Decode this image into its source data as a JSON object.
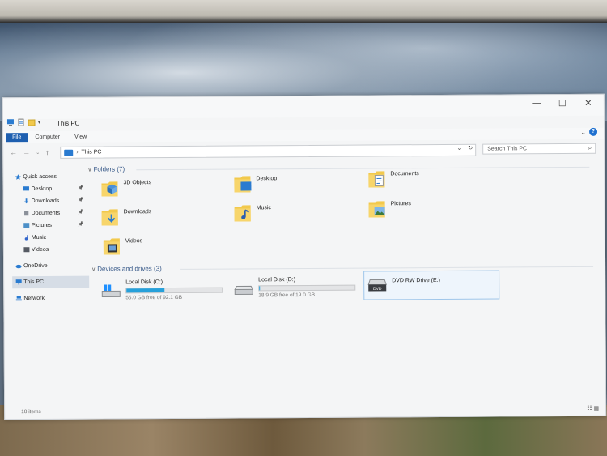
{
  "window": {
    "title": "This PC",
    "minimize": "—",
    "maximize": "☐",
    "close": "✕"
  },
  "ribbon": {
    "tabs": [
      "File",
      "Computer",
      "View"
    ],
    "expand": "⌄",
    "help": "?"
  },
  "address": {
    "path_separator": "›",
    "path": "This PC",
    "dropdown": "⌄",
    "refresh": "↻",
    "search_placeholder": "Search This PC"
  },
  "navpane": {
    "items": [
      {
        "label": "Quick access",
        "icon": "star-icon",
        "color": "#2a7bd0",
        "pinned": false,
        "sub": false
      },
      {
        "label": "Desktop",
        "icon": "desktop-icon",
        "color": "#2a7bd0",
        "pinned": true,
        "sub": true
      },
      {
        "label": "Downloads",
        "icon": "download-icon",
        "color": "#2a7bd0",
        "pinned": true,
        "sub": true
      },
      {
        "label": "Documents",
        "icon": "document-icon",
        "color": "#8a9099",
        "pinned": true,
        "sub": true
      },
      {
        "label": "Pictures",
        "icon": "picture-icon",
        "color": "#4c8fc7",
        "pinned": true,
        "sub": true
      },
      {
        "label": "Music",
        "icon": "music-icon",
        "color": "#3366cc",
        "pinned": false,
        "sub": true
      },
      {
        "label": "Videos",
        "icon": "video-icon",
        "color": "#555a63",
        "pinned": false,
        "sub": true
      },
      {
        "label": "OneDrive",
        "icon": "cloud-icon",
        "color": "#2a7bd0",
        "pinned": false,
        "sub": false
      },
      {
        "label": "This PC",
        "icon": "computer-icon",
        "color": "#2a7bd0",
        "pinned": false,
        "sub": false,
        "selected": true
      },
      {
        "label": "Network",
        "icon": "network-icon",
        "color": "#2a7bd0",
        "pinned": false,
        "sub": false
      }
    ]
  },
  "folders": {
    "header": "Folders (7)",
    "items": [
      {
        "label": "3D Objects",
        "icon": "3d-objects-folder-icon"
      },
      {
        "label": "Desktop",
        "icon": "desktop-folder-icon"
      },
      {
        "label": "Documents",
        "icon": "documents-folder-icon"
      },
      {
        "label": "Downloads",
        "icon": "downloads-folder-icon"
      },
      {
        "label": "Music",
        "icon": "music-folder-icon"
      },
      {
        "label": "Pictures",
        "icon": "pictures-folder-icon"
      },
      {
        "label": "Videos",
        "icon": "videos-folder-icon"
      }
    ]
  },
  "drives": {
    "header": "Devices and drives (3)",
    "items": [
      {
        "label": "Local Disk (C:)",
        "free": "55.0 GB free of 92.1 GB",
        "used_fraction": 0.4,
        "icon": "windows-drive-icon"
      },
      {
        "label": "Local Disk (D:)",
        "free": "18.9 GB free of 19.0 GB",
        "used_fraction": 0.01,
        "icon": "hard-drive-icon"
      },
      {
        "label": "DVD RW Drive (E:)",
        "free": "",
        "icon": "dvd-drive-icon",
        "badge": "DVD"
      }
    ]
  },
  "status": {
    "count": "10 items",
    "views": "☷ ▦"
  },
  "colors": {
    "accent": "#1e5fb0",
    "capacity_bar": "#26a0da",
    "folder": "#f2c94c"
  }
}
